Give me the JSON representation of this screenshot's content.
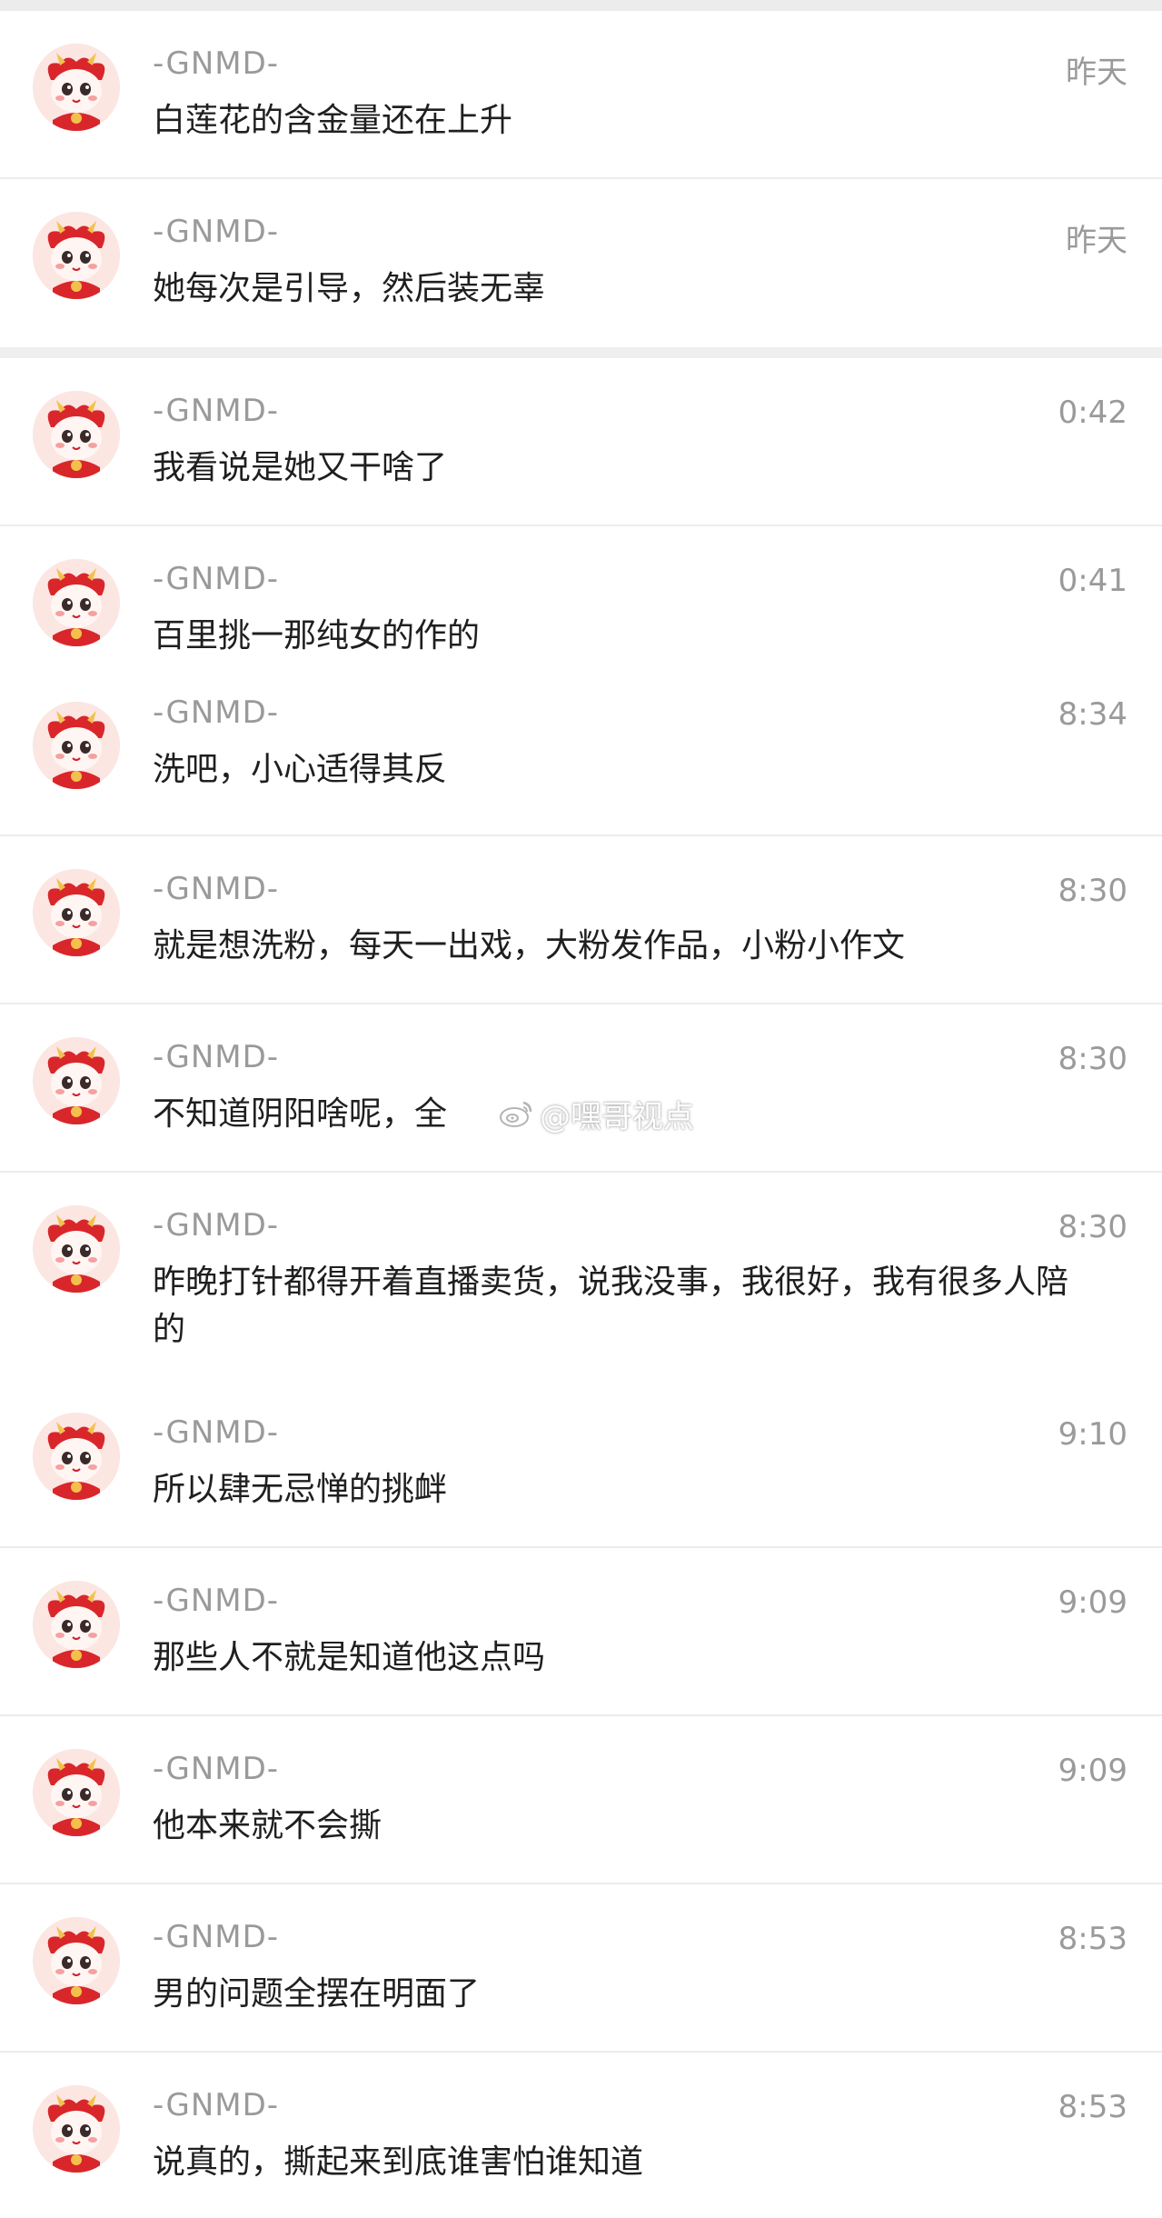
{
  "chats": [
    {
      "sender": "-GNMD-",
      "time": "昨天",
      "message": "白莲花的含金量还在上升"
    },
    {
      "sender": "-GNMD-",
      "time": "昨天",
      "message": "她每次是引导，然后装无辜"
    },
    {
      "sender": "-GNMD-",
      "time": "0:42",
      "message": "我看说是她又干啥了"
    },
    {
      "sender": "-GNMD-",
      "time": "0:41",
      "message": "百里挑一那纯女的作的"
    },
    {
      "sender": "-GNMD-",
      "time": "8:34",
      "message": "洗吧，小心适得其反"
    },
    {
      "sender": "-GNMD-",
      "time": "8:30",
      "message": "就是想洗粉，每天一出戏，大粉发作品，小粉小作文"
    },
    {
      "sender": "-GNMD-",
      "time": "8:30",
      "message": "不知道阴阳啥呢，全"
    },
    {
      "sender": "-GNMD-",
      "time": "8:30",
      "message": "昨晚打针都得开着直播卖货，说我没事，我很好，我有很多人陪的"
    },
    {
      "sender": "-GNMD-",
      "time": "9:10",
      "message": "所以肆无忌惮的挑衅"
    },
    {
      "sender": "-GNMD-",
      "time": "9:09",
      "message": "那些人不就是知道他这点吗"
    },
    {
      "sender": "-GNMD-",
      "time": "9:09",
      "message": "他本来就不会撕"
    },
    {
      "sender": "-GNMD-",
      "time": "8:53",
      "message": "男的问题全摆在明面了"
    },
    {
      "sender": "-GNMD-",
      "time": "8:53",
      "message": "说真的，撕起来到底谁害怕谁知道"
    }
  ],
  "watermark": {
    "text": "@嘿哥视点",
    "icon": "weibo-logo-icon"
  },
  "colors": {
    "background": "#ffffff",
    "separator": "#ececec",
    "sender": "#9a9a9a",
    "time": "#9a9a9a",
    "message": "#1f1f1f",
    "avatar_red": "#d9262b"
  }
}
